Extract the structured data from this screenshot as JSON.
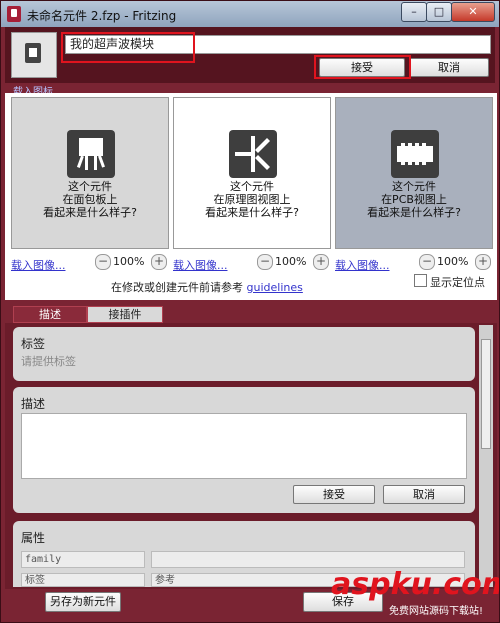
{
  "window": {
    "title": "未命名元件 2.fzp - Fritzing",
    "minimize": "–",
    "maximize": "□",
    "close": "✕"
  },
  "header": {
    "part_name_value": "我的超声波模块",
    "accept_label": "接受",
    "cancel_label": "取消",
    "load_icon_link": "载入图标..."
  },
  "views": [
    {
      "caption_line1": "这个元件",
      "caption_line2": "在面包板上",
      "caption_line3": "看起来是什么样子?",
      "load_link": "载入图像...",
      "zoom": "100%",
      "icon": "breadboard-icon"
    },
    {
      "caption_line1": "这个元件",
      "caption_line2": "在原理图视图上",
      "caption_line3": "看起来是什么样子?",
      "load_link": "载入图像...",
      "zoom": "100%",
      "icon": "schematic-icon"
    },
    {
      "caption_line1": "这个元件",
      "caption_line2": "在PCB视图上",
      "caption_line3": "看起来是什么样子?",
      "load_link": "载入图像...",
      "zoom": "100%",
      "icon": "pcb-icon"
    }
  ],
  "footnote_prefix": "在修改或创建元件前请参考",
  "footnote_link": "guidelines",
  "show_anchor_label": "显示定位点",
  "tabs": [
    {
      "label": "描述"
    },
    {
      "label": "接插件"
    }
  ],
  "tag_section": {
    "title": "标签",
    "placeholder": "请提供标签"
  },
  "desc_section": {
    "title": "描述",
    "accept_label": "接受",
    "cancel_label": "取消"
  },
  "props_section": {
    "title": "属性",
    "row1_key": "family",
    "row2_key": "标签",
    "row2_value": "参考"
  },
  "bottom": {
    "save_new_label": "另存为新元件",
    "save_label": "保存"
  },
  "watermark": {
    "logo": "aspku.com",
    "subtitle": "免费网站源码下载站!"
  },
  "colors": {
    "frame": "#7a2433",
    "highlight": "#e0141e"
  }
}
